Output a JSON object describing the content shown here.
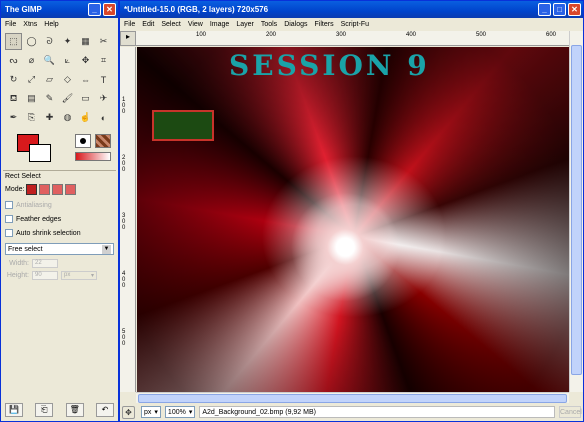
{
  "toolbox": {
    "title": "The GIMP",
    "menu": [
      "File",
      "Xtns",
      "Help"
    ],
    "tools": [
      {
        "name": "rect-select-icon",
        "glyph": "⬚"
      },
      {
        "name": "ellipse-select-icon",
        "glyph": "◯"
      },
      {
        "name": "free-select-icon",
        "glyph": "ᘐ"
      },
      {
        "name": "fuzzy-select-icon",
        "glyph": "✦"
      },
      {
        "name": "color-select-icon",
        "glyph": "▦"
      },
      {
        "name": "scissors-icon",
        "glyph": "✂"
      },
      {
        "name": "paths-icon",
        "glyph": "ᔓ"
      },
      {
        "name": "color-picker-icon",
        "glyph": "⌀"
      },
      {
        "name": "magnify-icon",
        "glyph": "🔍"
      },
      {
        "name": "measure-icon",
        "glyph": "⟀"
      },
      {
        "name": "move-icon",
        "glyph": "✥"
      },
      {
        "name": "crop-icon",
        "glyph": "⌗"
      },
      {
        "name": "rotate-icon",
        "glyph": "↻"
      },
      {
        "name": "scale-icon",
        "glyph": "⤢"
      },
      {
        "name": "shear-icon",
        "glyph": "▱"
      },
      {
        "name": "perspective-icon",
        "glyph": "◇"
      },
      {
        "name": "flip-icon",
        "glyph": "⇔"
      },
      {
        "name": "text-icon",
        "glyph": "T"
      },
      {
        "name": "bucket-fill-icon",
        "glyph": "⛾"
      },
      {
        "name": "blend-icon",
        "glyph": "▤"
      },
      {
        "name": "pencil-icon",
        "glyph": "✎"
      },
      {
        "name": "paintbrush-icon",
        "glyph": "🖌"
      },
      {
        "name": "eraser-icon",
        "glyph": "▭"
      },
      {
        "name": "airbrush-icon",
        "glyph": "✈"
      },
      {
        "name": "ink-icon",
        "glyph": "✒"
      },
      {
        "name": "clone-icon",
        "glyph": "⎘"
      },
      {
        "name": "heal-icon",
        "glyph": "✚"
      },
      {
        "name": "convolve-icon",
        "glyph": "◍"
      },
      {
        "name": "smudge-icon",
        "glyph": "☝"
      },
      {
        "name": "dodge-burn-icon",
        "glyph": "◐"
      }
    ],
    "fg_color": "#d8191c",
    "bg_color": "#ffffff"
  },
  "options": {
    "title": "Rect Select",
    "mode_label": "Mode:",
    "antialiasing": "Antialiasing",
    "feather": "Feather edges",
    "autoshrink": "Auto shrink selection",
    "select_value": "Free select",
    "width_label": "Width:",
    "width_value": "22",
    "height_label": "Height:",
    "height_value": "90",
    "unit": "px"
  },
  "image": {
    "title": "*Untitled-15.0 (RGB, 2 layers) 720x576",
    "menu": [
      "File",
      "Edit",
      "Select",
      "View",
      "Image",
      "Layer",
      "Tools",
      "Dialogs",
      "Filters",
      "Script-Fu"
    ],
    "ruler_top": [
      "100",
      "200",
      "300",
      "400",
      "500",
      "600"
    ],
    "ruler_left": [
      "100",
      "200",
      "300",
      "400",
      "500"
    ],
    "canvas_text": "SESSION 9",
    "accent_text_color": "#1aa3a8",
    "status": {
      "unit": "px",
      "zoom": "100%",
      "info": "A2d_Background_02.bmp (9,92 MB)",
      "cancel": "Cancel"
    }
  }
}
